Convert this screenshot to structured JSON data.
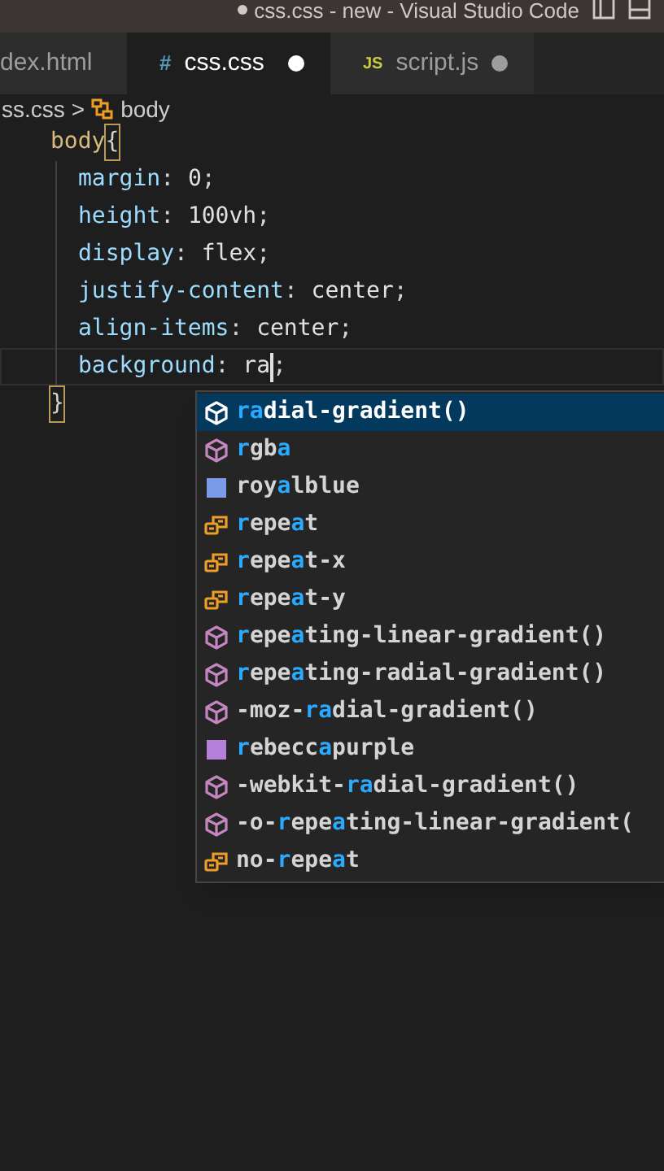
{
  "window": {
    "title": "css.css - new - Visual Studio Code",
    "dirty": true
  },
  "tabs": [
    {
      "label": "dex.html",
      "selected": false,
      "dirty": false
    },
    {
      "label": "css.css",
      "kind": "css",
      "icon": "#",
      "selected": true,
      "dirty": true
    },
    {
      "label": "script.js",
      "kind": "js",
      "icon": "JS",
      "selected": false,
      "dirty": true
    }
  ],
  "breadcrumb": {
    "file": "ss.css",
    "separator": ">",
    "symbol": "body"
  },
  "code": [
    {
      "current": false,
      "tokens": [
        {
          "kind": "selector",
          "text": "body"
        },
        {
          "kind": "bracket",
          "text": "{"
        }
      ]
    },
    {
      "current": false,
      "tokens": [
        {
          "kind": "property",
          "text": "margin"
        },
        {
          "kind": "punct",
          "text": ": "
        },
        {
          "kind": "value",
          "text": "0"
        },
        {
          "kind": "punct",
          "text": ";"
        }
      ]
    },
    {
      "current": false,
      "tokens": [
        {
          "kind": "property",
          "text": "height"
        },
        {
          "kind": "punct",
          "text": ": "
        },
        {
          "kind": "value",
          "text": "100vh"
        },
        {
          "kind": "punct",
          "text": ";"
        }
      ]
    },
    {
      "current": false,
      "tokens": [
        {
          "kind": "property",
          "text": "display"
        },
        {
          "kind": "punct",
          "text": ": "
        },
        {
          "kind": "value",
          "text": "flex"
        },
        {
          "kind": "punct",
          "text": ";"
        }
      ]
    },
    {
      "current": false,
      "tokens": [
        {
          "kind": "property",
          "text": "justify-content"
        },
        {
          "kind": "punct",
          "text": ": "
        },
        {
          "kind": "value",
          "text": "center"
        },
        {
          "kind": "punct",
          "text": ";"
        }
      ]
    },
    {
      "current": false,
      "tokens": [
        {
          "kind": "property",
          "text": "align-items"
        },
        {
          "kind": "punct",
          "text": ": "
        },
        {
          "kind": "value",
          "text": "center"
        },
        {
          "kind": "punct",
          "text": ";"
        }
      ]
    },
    {
      "current": true,
      "tokens": [
        {
          "kind": "property",
          "text": "background"
        },
        {
          "kind": "punct",
          "text": ": "
        },
        {
          "kind": "value",
          "text": "ra",
          "cursor_after": true
        },
        {
          "kind": "punct",
          "text": ";"
        }
      ]
    },
    {
      "current": false,
      "tokens": [
        {
          "kind": "bracket",
          "text": "}"
        }
      ]
    }
  ],
  "suggestions": [
    {
      "kind": "function",
      "selected": true,
      "parts": [
        {
          "text": "ra",
          "match": true
        },
        {
          "text": "dial-gradient()",
          "match": false
        }
      ]
    },
    {
      "kind": "function",
      "selected": false,
      "parts": [
        {
          "text": "r",
          "match": true
        },
        {
          "text": "gb",
          "match": false
        },
        {
          "text": "a",
          "match": true
        }
      ]
    },
    {
      "kind": "color",
      "color": "#7b9be8",
      "selected": false,
      "parts": [
        {
          "text": "roy",
          "match": false
        },
        {
          "text": "a",
          "match": true
        },
        {
          "text": "lblue",
          "match": false
        }
      ]
    },
    {
      "kind": "enum",
      "selected": false,
      "parts": [
        {
          "text": "r",
          "match": true
        },
        {
          "text": "epe",
          "match": false
        },
        {
          "text": "a",
          "match": true
        },
        {
          "text": "t",
          "match": false
        }
      ]
    },
    {
      "kind": "enum",
      "selected": false,
      "parts": [
        {
          "text": "r",
          "match": true
        },
        {
          "text": "epe",
          "match": false
        },
        {
          "text": "a",
          "match": true
        },
        {
          "text": "t-x",
          "match": false
        }
      ]
    },
    {
      "kind": "enum",
      "selected": false,
      "parts": [
        {
          "text": "r",
          "match": true
        },
        {
          "text": "epe",
          "match": false
        },
        {
          "text": "a",
          "match": true
        },
        {
          "text": "t-y",
          "match": false
        }
      ]
    },
    {
      "kind": "function",
      "selected": false,
      "parts": [
        {
          "text": "r",
          "match": true
        },
        {
          "text": "epe",
          "match": false
        },
        {
          "text": "a",
          "match": true
        },
        {
          "text": "ting-linear-gradient()",
          "match": false
        }
      ]
    },
    {
      "kind": "function",
      "selected": false,
      "parts": [
        {
          "text": "r",
          "match": true
        },
        {
          "text": "epe",
          "match": false
        },
        {
          "text": "a",
          "match": true
        },
        {
          "text": "ting-radial-gradient()",
          "match": false
        }
      ]
    },
    {
      "kind": "function",
      "selected": false,
      "parts": [
        {
          "text": "-moz-",
          "match": false
        },
        {
          "text": "ra",
          "match": true
        },
        {
          "text": "dial-gradient()",
          "match": false
        }
      ]
    },
    {
      "kind": "color",
      "color": "#b67fdc",
      "selected": false,
      "parts": [
        {
          "text": "r",
          "match": true
        },
        {
          "text": "ebecc",
          "match": false
        },
        {
          "text": "a",
          "match": true
        },
        {
          "text": "purple",
          "match": false
        }
      ]
    },
    {
      "kind": "function",
      "selected": false,
      "parts": [
        {
          "text": "-webkit-",
          "match": false
        },
        {
          "text": "ra",
          "match": true
        },
        {
          "text": "dial-gradient()",
          "match": false
        }
      ]
    },
    {
      "kind": "function",
      "selected": false,
      "parts": [
        {
          "text": "-o-",
          "match": false
        },
        {
          "text": "r",
          "match": true
        },
        {
          "text": "epe",
          "match": false
        },
        {
          "text": "a",
          "match": true
        },
        {
          "text": "ting-linear-gradient(",
          "match": false
        }
      ]
    },
    {
      "kind": "enum",
      "selected": false,
      "parts": [
        {
          "text": "no-",
          "match": false
        },
        {
          "text": "r",
          "match": true
        },
        {
          "text": "epe",
          "match": false
        },
        {
          "text": "a",
          "match": true
        },
        {
          "text": "t",
          "match": false
        }
      ]
    }
  ]
}
